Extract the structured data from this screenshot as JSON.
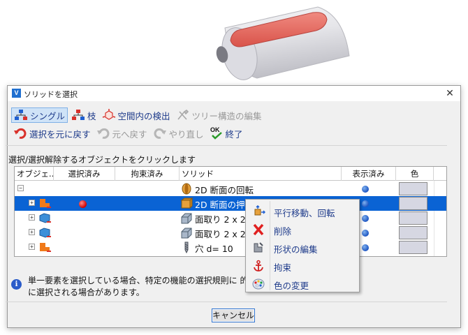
{
  "dialog": {
    "title": "ソリッドを選択",
    "close_glyph": "✕"
  },
  "toolbar": {
    "row1": [
      {
        "label": "シングル",
        "icon": "single-select-icon",
        "active": true,
        "disabled": false
      },
      {
        "label": "枝",
        "icon": "branch-select-icon",
        "active": false,
        "disabled": false
      },
      {
        "label": "空間内の検出",
        "icon": "spatial-detect-icon",
        "active": false,
        "disabled": false
      },
      {
        "label": "ツリー構造の編集",
        "icon": "tree-edit-icon",
        "active": false,
        "disabled": true
      }
    ],
    "row2": [
      {
        "label": "選択を元に戻す",
        "icon": "undo-selection-icon",
        "disabled": false
      },
      {
        "label": "元へ戻す",
        "icon": "undo-icon",
        "disabled": true
      },
      {
        "label": "やり直し",
        "icon": "redo-icon",
        "disabled": true
      },
      {
        "label": "終了",
        "icon": "ok-finish-icon",
        "badge": "OK",
        "disabled": false
      }
    ]
  },
  "instruction": "選択/選択解除するオブジェクトをクリックします",
  "grid": {
    "columns": [
      "オブジェ...",
      "選択済み",
      "拘束済み",
      "ソリッド",
      "表示済み",
      "色"
    ],
    "rows": [
      {
        "tree": "minus",
        "object_icon": "none",
        "selected": false,
        "solid_icon": "revolve-icon",
        "solid": "2D 断面の回転",
        "visible": true,
        "color": "#d6d7e2",
        "highlight": false
      },
      {
        "tree": "plus",
        "object_icon": "part-orange-icon",
        "selected": true,
        "solid_icon": "extrude-icon",
        "solid": "2D 断面の押",
        "visible": true,
        "color": "#d6d7e2",
        "highlight": true
      },
      {
        "tree": "plus",
        "object_icon": "part-blue-icon",
        "selected": false,
        "solid_icon": "chamfer-icon",
        "solid": "面取り 2 x 2",
        "visible": true,
        "color": "#d6d7e2",
        "highlight": false
      },
      {
        "tree": "plus",
        "object_icon": "part-blue-icon",
        "selected": false,
        "solid_icon": "chamfer-icon",
        "solid": "面取り 2 x 2",
        "visible": true,
        "color": "#d6d7e2",
        "highlight": false
      },
      {
        "tree": "plus",
        "object_icon": "part-orange-icon",
        "selected": false,
        "solid_icon": "hole-drill-icon",
        "solid": "穴 d= 10",
        "visible": true,
        "color": "#d6d7e2",
        "highlight": false
      }
    ]
  },
  "info": {
    "text": "単一要素を選択している場合、特定の機能の選択規則に 的に選択される場合があります。"
  },
  "buttons": {
    "cancel": "キャンセル"
  },
  "context_menu": {
    "items": [
      {
        "label": "平行移動、回転",
        "icon": "move-rotate-icon"
      },
      {
        "label": "削除",
        "icon": "delete-icon"
      },
      {
        "label": "形状の編集",
        "icon": "edit-shape-icon"
      },
      {
        "label": "拘束",
        "icon": "constraint-anchor-icon"
      },
      {
        "label": "色の変更",
        "icon": "color-palette-icon"
      }
    ]
  },
  "colors": {
    "accent": "#0a63d4",
    "link_text": "#1d3a8a",
    "highlight_face": "#e0635c"
  }
}
